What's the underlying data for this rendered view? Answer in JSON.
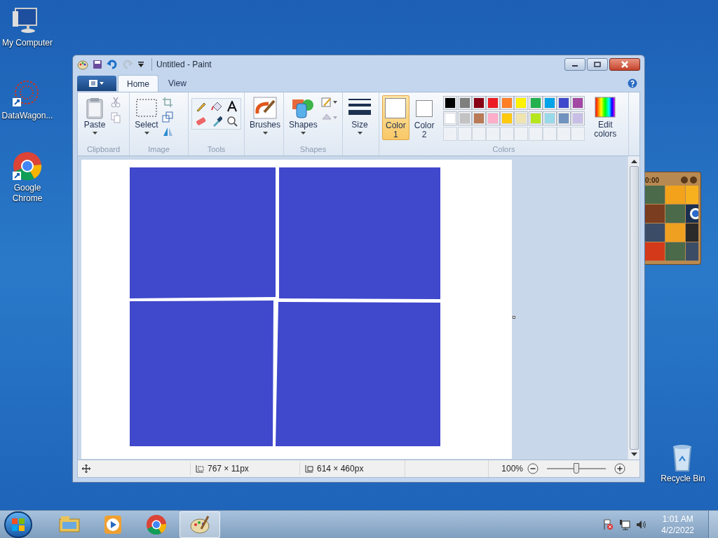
{
  "desktop_icons": [
    {
      "kind": "computer",
      "label": "My Computer"
    },
    {
      "kind": "datawagon",
      "label": "DataWagon..."
    },
    {
      "kind": "chrome",
      "label": "Google Chrome"
    },
    {
      "kind": "recycle",
      "label": "Recycle Bin"
    }
  ],
  "gadget": {
    "time": "0:00"
  },
  "window": {
    "title": "Untitled - Paint"
  },
  "tabs": [
    {
      "label": "Home",
      "selected": true
    },
    {
      "label": "View",
      "selected": false
    }
  ],
  "ribbon": {
    "groups": [
      {
        "kind": "clipboard",
        "label": "Clipboard",
        "buttons": [
          "Paste"
        ]
      },
      {
        "kind": "image",
        "label": "Image",
        "buttons": [
          "Select"
        ]
      },
      {
        "kind": "tools",
        "label": "Tools"
      },
      {
        "kind": "brushes",
        "buttons": [
          "Brushes"
        ]
      },
      {
        "kind": "shapes",
        "label": "Shapes",
        "buttons": [
          "Shapes"
        ]
      },
      {
        "kind": "size",
        "buttons": [
          "Size"
        ]
      },
      {
        "kind": "colors",
        "label": "Colors",
        "buttons": [
          "Edit colors"
        ]
      }
    ]
  },
  "color_slots": [
    {
      "label": "Color",
      "number": "1",
      "selected": true,
      "color": "#ffffff"
    },
    {
      "label": "Color",
      "number": "2",
      "selected": false,
      "color": "#ffffff"
    }
  ],
  "palette": [
    {
      "color": "#000000"
    },
    {
      "color": "#7f7f7f"
    },
    {
      "color": "#880015"
    },
    {
      "color": "#ed1c24"
    },
    {
      "color": "#ff7f27"
    },
    {
      "color": "#fff200"
    },
    {
      "color": "#22b14c"
    },
    {
      "color": "#00a2e8"
    },
    {
      "color": "#3f48cc"
    },
    {
      "color": "#a349a4"
    },
    {
      "color": "#ffffff"
    },
    {
      "color": "#c3c3c3"
    },
    {
      "color": "#b97a57"
    },
    {
      "color": "#ffaec9"
    },
    {
      "color": "#ffc90e"
    },
    {
      "color": "#efe4b0"
    },
    {
      "color": "#b5e61d"
    },
    {
      "color": "#99d9ea"
    },
    {
      "color": "#7092be"
    },
    {
      "color": "#c8bfe7"
    }
  ],
  "status_bar": {
    "selection_size": "767 × 11px",
    "image_size": "614 × 460px",
    "zoom": "100%",
    "zoom_slider": {
      "level": 0.5
    }
  },
  "taskbar": {
    "apps": [
      {
        "kind": "explorer",
        "selected": false
      },
      {
        "kind": "media",
        "selected": false
      },
      {
        "kind": "chrome",
        "selected": false
      },
      {
        "kind": "paint",
        "selected": true
      }
    ],
    "time": "1:01 AM",
    "date": "4/2/2022"
  }
}
